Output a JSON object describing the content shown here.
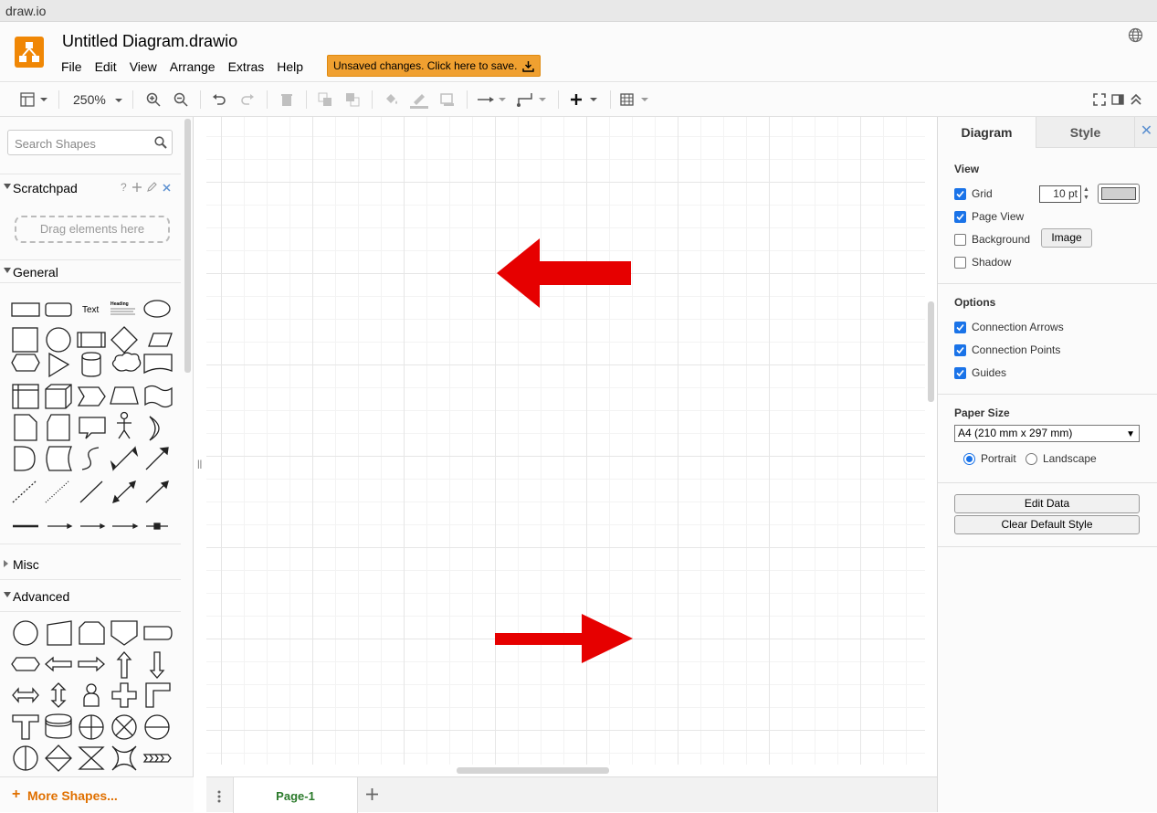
{
  "window": {
    "title": "draw.io"
  },
  "header": {
    "doc_title": "Untitled Diagram.drawio",
    "menu": [
      "File",
      "Edit",
      "View",
      "Arrange",
      "Extras",
      "Help"
    ],
    "save_notice": "Unsaved changes. Click here to save."
  },
  "toolbar": {
    "zoom": "250%"
  },
  "sidebar": {
    "search_placeholder": "Search Shapes",
    "scratchpad_label": "Scratchpad",
    "scratchpad_help": "?",
    "drag_hint": "Drag elements here",
    "sections": {
      "general": "General",
      "misc": "Misc",
      "advanced": "Advanced"
    },
    "text_shape_label": "Text",
    "heading_shape_label": "Heading",
    "more_shapes": "More Shapes..."
  },
  "canvas": {
    "arrows": [
      {
        "direction": "left",
        "color": "#e60000"
      },
      {
        "direction": "right",
        "color": "#e60000"
      }
    ]
  },
  "pages": {
    "tabs": [
      "Page-1"
    ]
  },
  "format_panel": {
    "tabs": [
      "Diagram",
      "Style"
    ],
    "view": {
      "title": "View",
      "grid_label": "Grid",
      "grid_checked": true,
      "grid_size": "10 pt",
      "page_view_label": "Page View",
      "page_view_checked": true,
      "background_label": "Background",
      "background_checked": false,
      "image_button": "Image",
      "shadow_label": "Shadow",
      "shadow_checked": false
    },
    "options": {
      "title": "Options",
      "connection_arrows": "Connection Arrows",
      "connection_points": "Connection Points",
      "guides": "Guides"
    },
    "paper": {
      "title": "Paper Size",
      "size": "A4 (210 mm x 297 mm)",
      "portrait": "Portrait",
      "landscape": "Landscape",
      "orientation": "portrait"
    },
    "buttons": {
      "edit_data": "Edit Data",
      "clear_default_style": "Clear Default Style"
    }
  },
  "colors": {
    "accent": "#f08705",
    "save_notice_bg": "#f0a030",
    "arrow": "#e60000",
    "page_tab": "#2b7a2b",
    "checkbox": "#1a73e8"
  }
}
